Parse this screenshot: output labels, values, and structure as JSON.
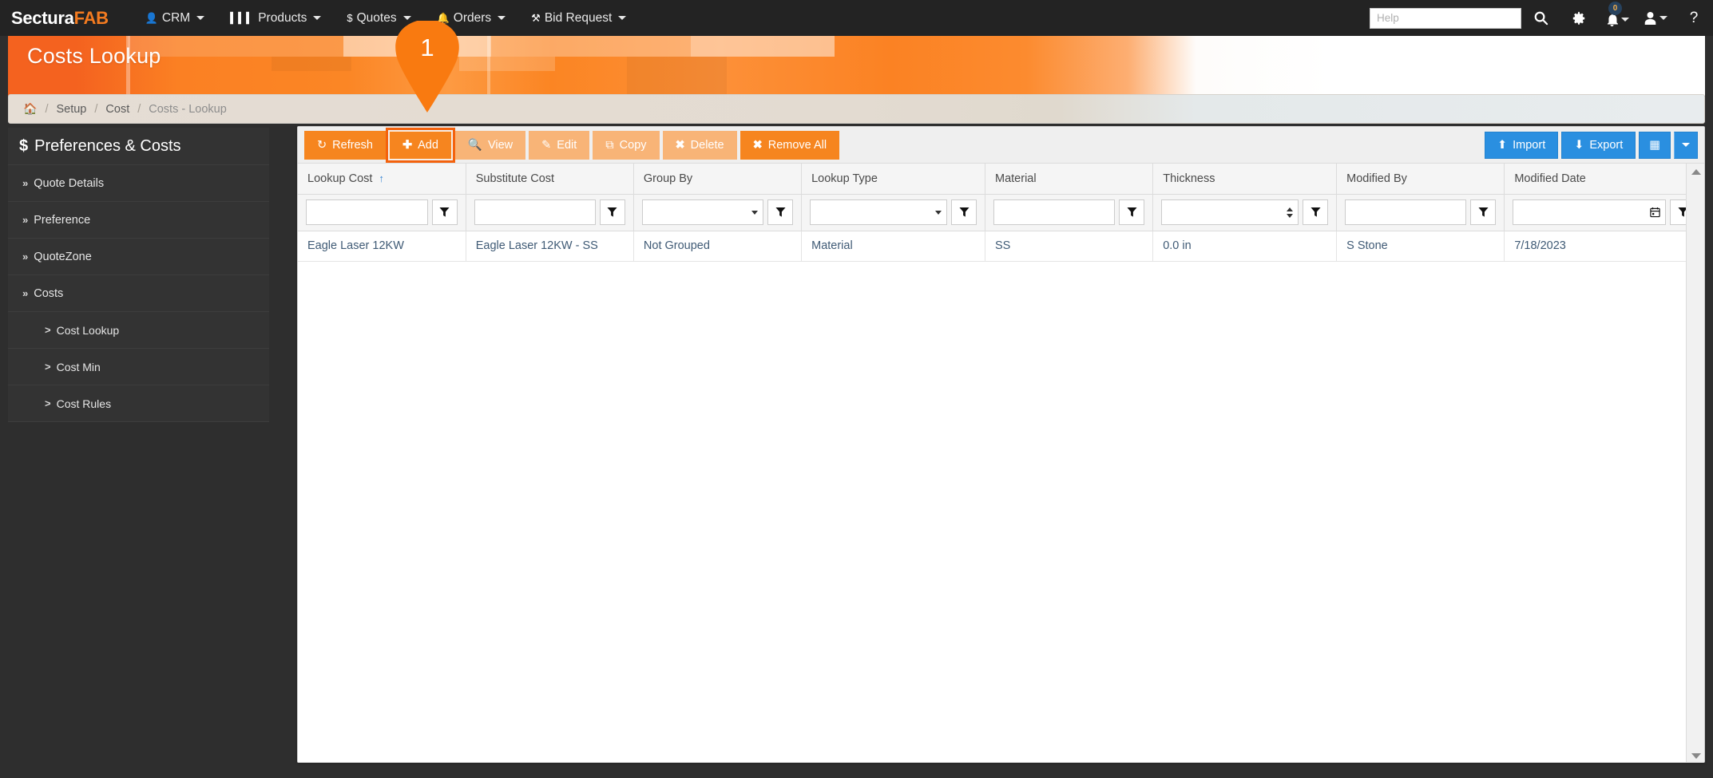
{
  "navbar": {
    "brand_primary": "Sectura",
    "brand_accent": "FAB",
    "items": [
      {
        "label": "CRM",
        "icon": "user-icon",
        "caret": true
      },
      {
        "label": "Products",
        "icon": "grid-bars-icon",
        "caret": true
      },
      {
        "label": "Quotes",
        "icon": "dollar-icon",
        "caret": true
      },
      {
        "label": "Orders",
        "icon": "bell-icon",
        "caret": true
      },
      {
        "label": "Bid Request",
        "icon": "wrench-icon",
        "caret": true
      }
    ],
    "help_placeholder": "Help",
    "help_value": "",
    "notification_count": "0",
    "icons": {
      "search": "search-icon",
      "settings": "gear-icon",
      "notifications": "bell-icon",
      "user": "user-icon",
      "help": "question-mark-icon"
    }
  },
  "header": {
    "title": "Costs Lookup"
  },
  "breadcrumb": {
    "home_icon": "home-icon",
    "items": [
      "Setup",
      "Cost"
    ],
    "active": "Costs - Lookup",
    "separator": "/"
  },
  "sidebar": {
    "heading": "Preferences & Costs",
    "heading_icon": "dollar-icon",
    "items": [
      {
        "label": "Quote Details",
        "arrow": "»",
        "sub": false
      },
      {
        "label": "Preference",
        "arrow": "»",
        "sub": false
      },
      {
        "label": "QuoteZone",
        "arrow": "»",
        "sub": false
      },
      {
        "label": "Costs",
        "arrow": "»",
        "sub": false
      },
      {
        "label": "Cost Lookup",
        "arrow": ">",
        "sub": true
      },
      {
        "label": "Cost Min",
        "arrow": ">",
        "sub": true
      },
      {
        "label": "Cost Rules",
        "arrow": ">",
        "sub": true
      }
    ]
  },
  "toolbar": {
    "buttons": [
      {
        "label": "Refresh",
        "icon": "refresh-icon",
        "state": "enabled"
      },
      {
        "label": "Add",
        "icon": "plus-icon",
        "state": "highlighted"
      },
      {
        "label": "View",
        "icon": "magnifier-icon",
        "state": "disabled"
      },
      {
        "label": "Edit",
        "icon": "pencil-square-icon",
        "state": "disabled"
      },
      {
        "label": "Copy",
        "icon": "copy-icon",
        "state": "disabled"
      },
      {
        "label": "Delete",
        "icon": "x-icon",
        "state": "disabled"
      },
      {
        "label": "Remove All",
        "icon": "x-icon",
        "state": "enabled"
      }
    ],
    "import_label": "Import",
    "import_icon": "upload-icon",
    "export_label": "Export",
    "export_icon": "download-icon",
    "columns_icon": "table-grid-icon",
    "columns_caret_icon": "chevron-down-icon"
  },
  "grid": {
    "columns": [
      {
        "label": "Lookup Cost",
        "sorted": "asc",
        "filter": "text"
      },
      {
        "label": "Substitute Cost",
        "sorted": null,
        "filter": "text"
      },
      {
        "label": "Group By",
        "sorted": null,
        "filter": "select"
      },
      {
        "label": "Lookup Type",
        "sorted": null,
        "filter": "select"
      },
      {
        "label": "Material",
        "sorted": null,
        "filter": "text"
      },
      {
        "label": "Thickness",
        "sorted": null,
        "filter": "number"
      },
      {
        "label": "Modified By",
        "sorted": null,
        "filter": "text"
      },
      {
        "label": "Modified Date",
        "sorted": null,
        "filter": "date"
      }
    ],
    "filter_values": [
      "",
      "",
      "",
      "",
      "",
      "",
      "",
      ""
    ],
    "sort_asc_glyph": "↑",
    "filter_icon": "funnel-icon",
    "calendar_icon": "calendar-icon",
    "rows": [
      {
        "lookup_cost": "Eagle Laser 12KW",
        "substitute_cost": "Eagle Laser 12KW - SS",
        "group_by": "Not Grouped",
        "lookup_type": "Material",
        "material": "SS",
        "thickness": "0.0 in",
        "modified_by": "S Stone",
        "modified_date": "7/18/2023"
      }
    ]
  },
  "annotation": {
    "pin_number": "1"
  },
  "colors": {
    "brand_orange": "#f6851f",
    "navbar_dark": "#232323",
    "sidebar_dark": "#333333",
    "blue_action": "#2a8fe0",
    "link_blue": "#3f5a75",
    "page_bg": "#2e2e2e"
  }
}
